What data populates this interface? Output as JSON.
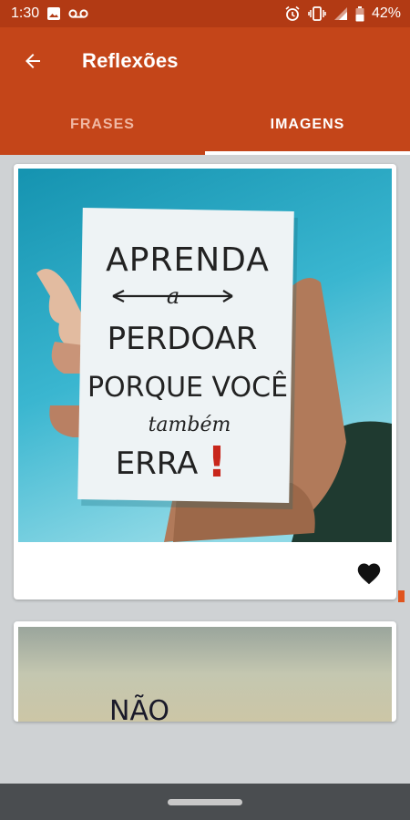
{
  "status_bar": {
    "time": "1:30",
    "battery": "42%",
    "left_icons": [
      "image-notification-icon",
      "voicemail-icon"
    ],
    "right_icons": [
      "alarm-icon",
      "vibrate-icon",
      "signal-icon",
      "battery-icon"
    ]
  },
  "app_bar": {
    "title": "Reflexões",
    "back_icon": "arrow-back-icon"
  },
  "tabs": [
    {
      "label": "FRASES",
      "active": false
    },
    {
      "label": "IMAGENS",
      "active": true
    }
  ],
  "cards": [
    {
      "image_text": [
        "APRENDA",
        "a",
        "PERDOAR",
        "PORQUE VOCÊ",
        "também",
        "ERRA",
        "!"
      ],
      "favorite_icon": "heart-icon"
    },
    {
      "image_text": [
        "NÃO"
      ]
    }
  ],
  "colors": {
    "status_bar": "#b23a14",
    "app_bar": "#c44519",
    "tab_inactive": "#f0b8a3",
    "background": "#cfd2d4",
    "nav_bar": "#4a4d50"
  }
}
